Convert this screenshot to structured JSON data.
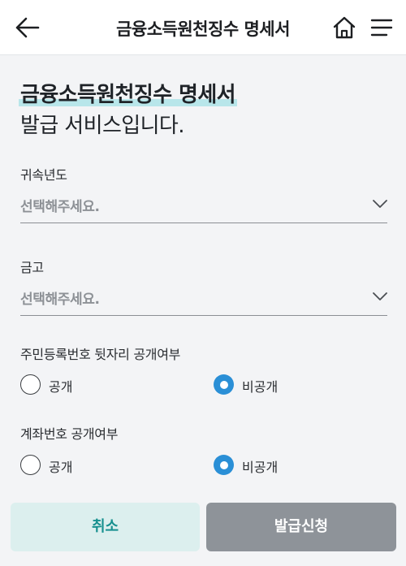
{
  "header": {
    "title": "금융소득원천징수 명세서",
    "back_icon": "arrow-left-icon",
    "home_icon": "home-icon",
    "menu_icon": "hamburger-menu-icon"
  },
  "intro": {
    "strong": "금융소득원천징수 명세서",
    "rest": "발급 서비스입니다."
  },
  "form": {
    "year": {
      "label": "귀속년도",
      "placeholder": "선택해주세요."
    },
    "bank": {
      "label": "금고",
      "placeholder": "선택해주세요."
    },
    "resident_number": {
      "label": "주민등록번호 뒷자리 공개여부",
      "options": [
        "공개",
        "비공개"
      ],
      "selected": "비공개"
    },
    "account_number": {
      "label": "계좌번호 공개여부",
      "options": [
        "공개",
        "비공개"
      ],
      "selected": "비공개"
    }
  },
  "buttons": {
    "cancel": "취소",
    "apply": "발급신청"
  },
  "colors": {
    "accent": "#2a8fd6",
    "highlight": "#b8e6ea",
    "cancel_bg": "#dcefee",
    "cancel_text": "#17908f",
    "apply_bg": "#8e9399"
  }
}
